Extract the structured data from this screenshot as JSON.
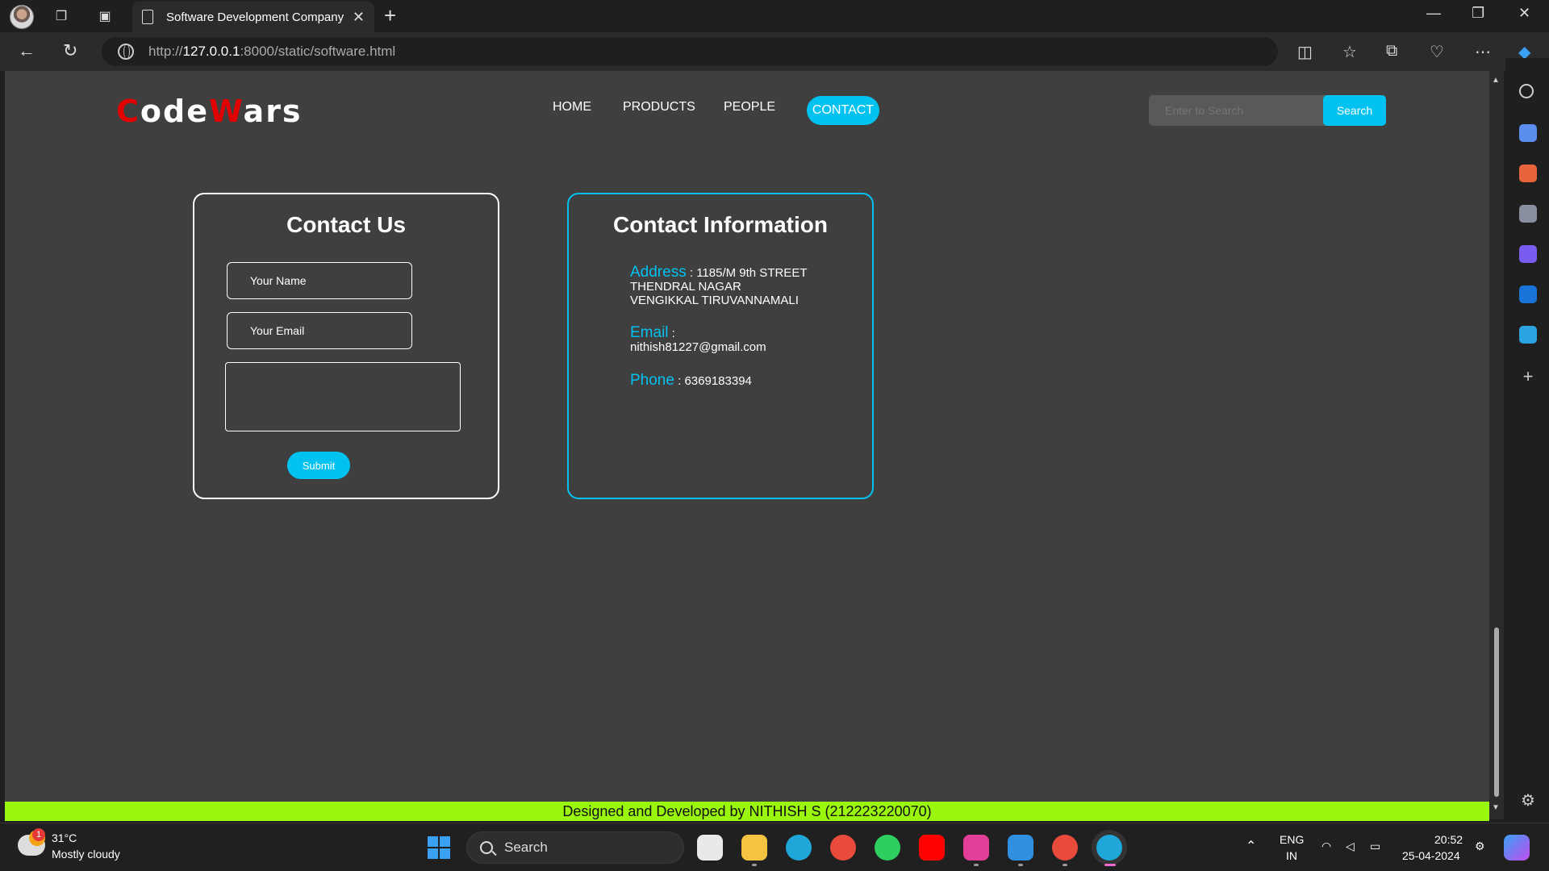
{
  "browser": {
    "tab_title": "Software Development Company",
    "url_prefix": "http://",
    "url_host": "127.0.0.1",
    "url_rest": ":8000/static/software.html"
  },
  "site": {
    "logo": {
      "c": "C",
      "ode": "ode",
      "w": "W",
      "ars": "ars"
    },
    "nav": {
      "home": "HOME",
      "products": "PRODUCTS",
      "people": "PEOPLE",
      "contact": "CONTACT"
    },
    "search": {
      "placeholder": "Enter to Search",
      "button": "Search"
    },
    "contact_form": {
      "title": "Contact Us",
      "name_placeholder": "Your Name",
      "email_placeholder": "Your Email",
      "submit": "Submit"
    },
    "contact_info": {
      "title": "Contact Information",
      "address_label": "Address",
      "address_line1": " : 1185/M 9th STREET",
      "address_line2": "THENDRAL NAGAR",
      "address_line3": "VENGIKKAL TIRUVANNAMALI",
      "email_label": "Email",
      "email_sep": " :",
      "email_value": "nithish81227@gmail.com",
      "phone_label": "Phone",
      "phone_value": " : 6369183394"
    },
    "footer": "Designed and Developed by NITHISH S (212223220070)"
  },
  "taskbar": {
    "weather_badge": "1",
    "temperature": "31°C",
    "weather": "Mostly cloudy",
    "search": "Search",
    "lang1": "ENG",
    "lang2": "IN",
    "time": "20:52",
    "date": "25-04-2024"
  },
  "colors": {
    "accent": "#00c2f0",
    "logo_red": "#e00000",
    "footer": "#9af60d",
    "page_bg": "#3f3f3f"
  }
}
